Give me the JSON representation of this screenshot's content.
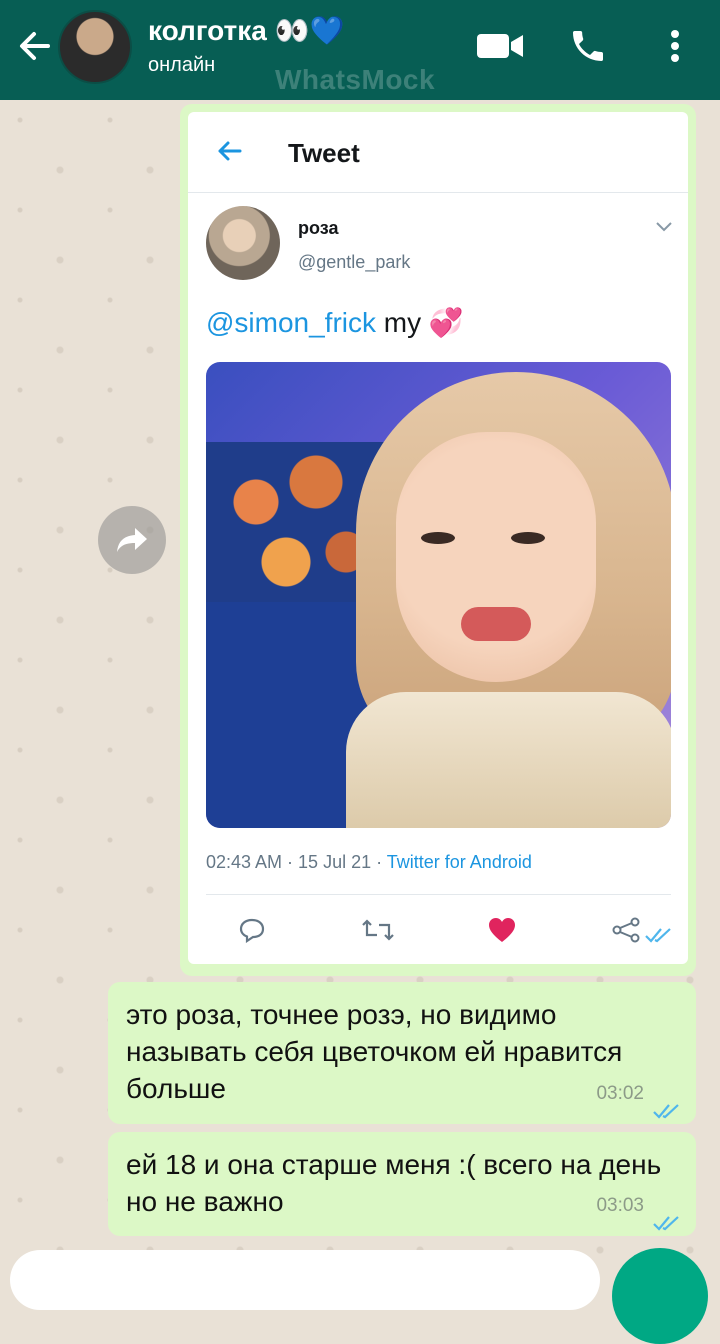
{
  "header": {
    "contact_name": "колготка 👀💙",
    "status": "онлайн",
    "watermark": "WhatsMock",
    "icons": [
      "back-arrow-icon",
      "video-call-icon",
      "phone-icon",
      "more-vert-icon"
    ]
  },
  "tweet": {
    "topbar_title": "Tweet",
    "author_name": "роза",
    "author_handle": "@gentle_park",
    "mention": "@simon_frick",
    "text_after": " my 💞",
    "meta_time": "02:43 AM · 15 Jul 21 · ",
    "meta_source": "Twitter for Android",
    "actions": [
      "reply-icon",
      "retweet-icon",
      "like-icon",
      "share-icon"
    ],
    "like_color": "#e0245e",
    "link_color": "#1b95e0"
  },
  "messages": [
    {
      "text": "это роза, точнее розэ, но видимо называть себя цветочком ей нравится больше",
      "time": "03:02"
    },
    {
      "text": "ей 18 и она старше меня :( всего на день но не важно",
      "time": "03:03"
    }
  ],
  "colors": {
    "header_bg": "#075e54",
    "bubble_out": "#dcf8c6",
    "chat_bg": "#e9e1d6",
    "read_tick": "#4fb6ec"
  }
}
